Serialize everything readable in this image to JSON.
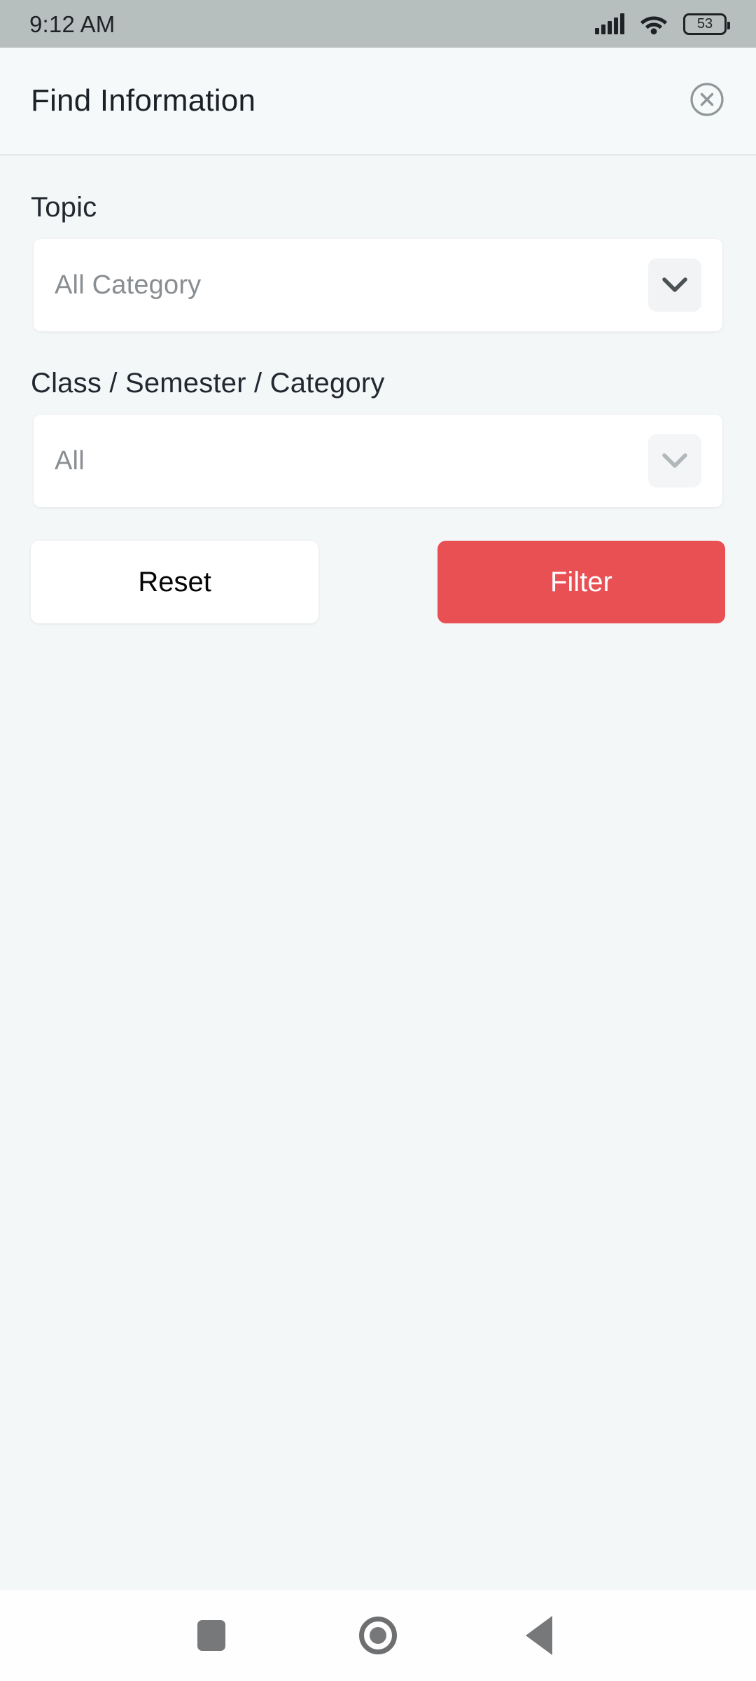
{
  "status_bar": {
    "time": "9:12 AM",
    "signal_icon": "signal-bars-icon",
    "wifi_icon": "wifi-icon",
    "battery_icon": "battery-icon",
    "battery_level": "53"
  },
  "header": {
    "title": "Find Information",
    "close_icon": "close-circle-icon"
  },
  "form": {
    "topic": {
      "label": "Topic",
      "value": "All Category",
      "placeholder": "All Category",
      "chevron_icon": "chevron-down-icon"
    },
    "class_semester_category": {
      "label": "Class / Semester / Category",
      "value": "All",
      "placeholder": "All",
      "chevron_icon": "chevron-down-icon"
    }
  },
  "actions": {
    "reset_label": "Reset",
    "filter_label": "Filter"
  },
  "nav_bar": {
    "recents_icon": "square-icon",
    "home_icon": "circle-icon",
    "back_icon": "triangle-back-icon"
  },
  "colors": {
    "accent": "#e85054",
    "background": "#f4f7f8",
    "status_bar": "#b7bebe",
    "surface": "#ffffff",
    "text_primary": "#1c2127",
    "text_muted": "#898e92"
  }
}
